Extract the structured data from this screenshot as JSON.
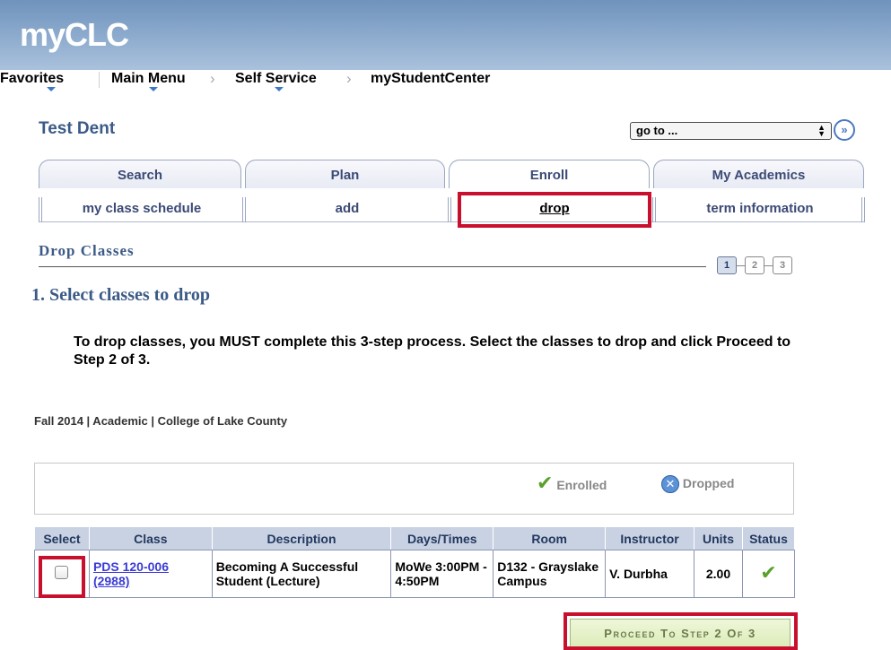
{
  "app": {
    "logo": "myCLC"
  },
  "nav": {
    "items": [
      {
        "label": "Favorites"
      },
      {
        "label": "Main Menu"
      },
      {
        "label": "Self Service"
      },
      {
        "label": "myStudentCenter"
      }
    ],
    "separator": "›"
  },
  "student": {
    "name": "Test Dent"
  },
  "goto": {
    "label": "go to ...",
    "button_icon": "double-chevron-right-icon"
  },
  "tabs": [
    {
      "label": "Search"
    },
    {
      "label": "Plan"
    },
    {
      "label": "Enroll",
      "active": true
    },
    {
      "label": "My Academics"
    }
  ],
  "subtabs": [
    {
      "label": "my class schedule"
    },
    {
      "label": "add"
    },
    {
      "label": "drop",
      "active": true
    },
    {
      "label": "term information"
    }
  ],
  "page": {
    "section_title": "Drop Classes",
    "steps": [
      "1",
      "2",
      "3"
    ],
    "current_step": 1,
    "subtitle": "1.  Select classes to drop",
    "instructions": "To drop classes, you MUST complete this 3-step process.  Select the classes to drop and click Proceed to Step 2 of 3.",
    "term": "Fall 2014 | Academic | College of Lake County"
  },
  "legend": {
    "enrolled": "Enrolled",
    "dropped": "Dropped"
  },
  "table": {
    "headers": [
      "Select",
      "Class",
      "Description",
      "Days/Times",
      "Room",
      "Instructor",
      "Units",
      "Status"
    ],
    "rows": [
      {
        "class_code": "PDS 120-006",
        "class_number": "(2988)",
        "description": "Becoming A Successful Student (Lecture)",
        "days_times": "MoWe 3:00PM - 4:50PM",
        "room": "D132 - Grayslake Campus",
        "instructor": "V. Durbha",
        "units": "2.00",
        "status": "enrolled",
        "selected": false
      }
    ]
  },
  "proceed_button": {
    "label": "Proceed To Step 2 Of 3"
  },
  "colors": {
    "banner": "#7f9fc6",
    "highlight": "#c8102e",
    "enrolled": "#5aa02c"
  }
}
